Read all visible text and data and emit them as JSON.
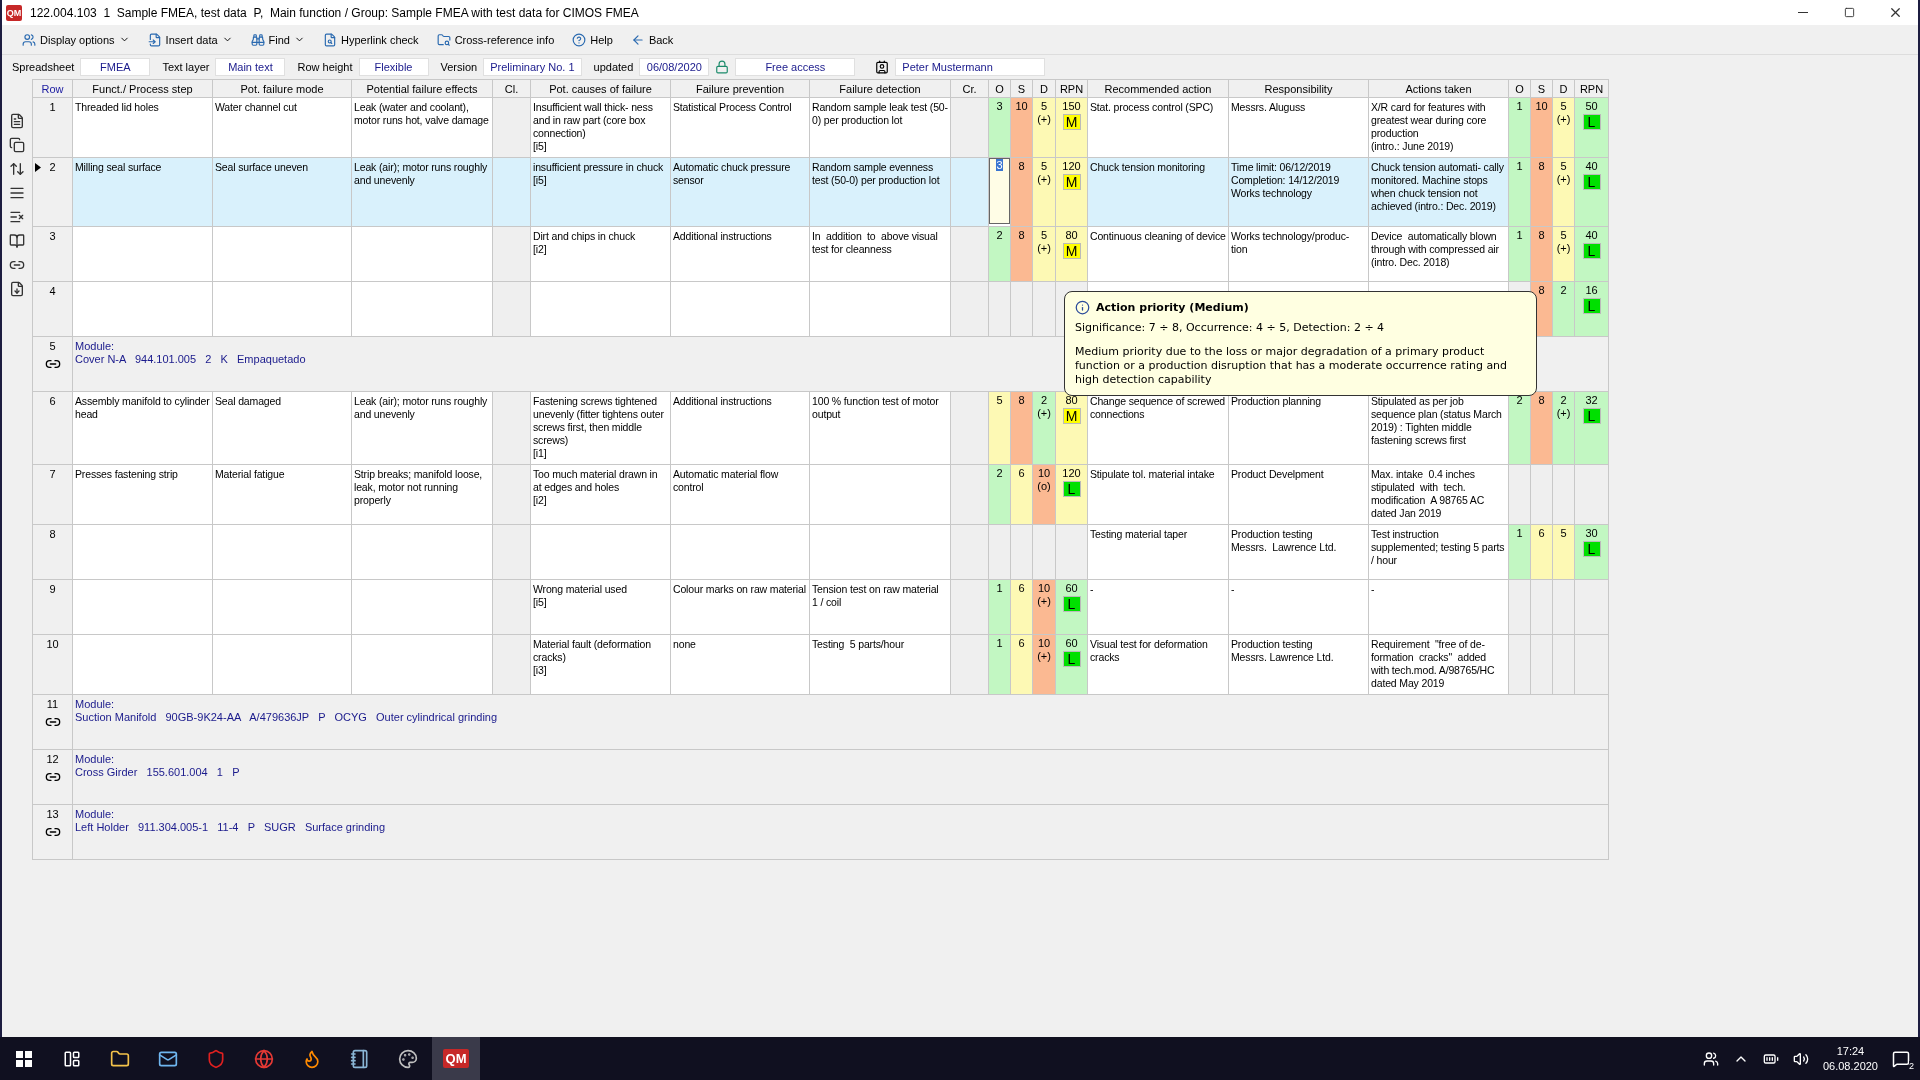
{
  "window": {
    "title": "122.004.103  1  Sample FMEA, test data  P,  Main function / Group: Sample FMEA with test data for CIMOS FMEA",
    "app_icon": "QM"
  },
  "toolbar": [
    {
      "label": "Display options",
      "dropdown": true
    },
    {
      "label": "Insert data",
      "dropdown": true
    },
    {
      "label": "Find",
      "dropdown": true
    },
    {
      "label": "Hyperlink check",
      "dropdown": false
    },
    {
      "label": "Cross-reference info",
      "dropdown": false
    },
    {
      "label": "Help",
      "dropdown": false
    },
    {
      "label": "Back",
      "dropdown": false
    }
  ],
  "settings": [
    {
      "label": "Spreadsheet",
      "value": "FMEA"
    },
    {
      "label": "Text layer",
      "value": "Main text"
    },
    {
      "label": "Row height",
      "value": "Flexible"
    },
    {
      "label": "Version",
      "value": "Preliminary No. 1"
    },
    {
      "label": "updated",
      "value": "06/08/2020"
    }
  ],
  "access": "Free access",
  "user": "Peter Mustermann",
  "table": {
    "columns": [
      "Row",
      "Funct./ Process step",
      "Pot. failure mode",
      "Potential failure effects",
      "Cl.",
      "Pot. causes of failure",
      "Failure prevention",
      "Failure detection",
      "Cr.",
      "O",
      "S",
      "D",
      "RPN",
      "Recommended action",
      "Responsibility",
      "Actions taken",
      "O",
      "S",
      "D",
      "RPN"
    ],
    "rows": [
      {
        "kind": "entry",
        "row": "1",
        "selected": false,
        "function": "Threaded lid holes",
        "failure_mode": "Water channel cut",
        "effects": "Leak (water and coolant), motor runs hot, valve damage",
        "causes": "Insufficient wall thick- ness and in raw part (core box connection)\n[i5]",
        "prevention": "Statistical Process Control",
        "detection": "Random sample leak test (50-0) per production lot",
        "before": {
          "o": "3",
          "s": "10",
          "d": "5",
          "d_note": "(+)",
          "rpn": "150",
          "ap": {
            "label": "M",
            "color": "#ffff00"
          },
          "focused": false
        },
        "action": "Stat. process control (SPC)",
        "responsibility": "Messrs. Aluguss",
        "taken": "X/R card for features with greatest wear during core production\n(intro.: June 2019)",
        "after": {
          "o": "1",
          "s": "10",
          "d": "5",
          "d_note": "(+)",
          "rpn": "50",
          "ap": {
            "label": "L",
            "color": "#00e000"
          }
        }
      },
      {
        "kind": "entry",
        "row": "2",
        "selected": true,
        "function": "Milling seal surface",
        "failure_mode": "Seal surface uneven",
        "effects": "Leak (air); motor runs roughly and unevenly",
        "causes": "insufficient pressure in chuck\n[i5]",
        "prevention": "Automatic chuck pressure sensor",
        "detection": "Random sample evenness test (50-0) per production lot",
        "before": {
          "o": "3",
          "s": "8",
          "d": "5",
          "d_note": "(+)",
          "rpn": "120",
          "ap": {
            "label": "M",
            "color": "#ffff00"
          },
          "focused": true
        },
        "action": "Chuck tension monitoring",
        "responsibility": "Time limit: 06/12/2019\nCompletion: 14/12/2019\nWorks technology",
        "taken": "Chuck tension automati- cally monitored. Machine stops when chuck tension not achieved (intro.: Dec. 2019)",
        "after": {
          "o": "1",
          "s": "8",
          "d": "5",
          "d_note": "(+)",
          "rpn": "40",
          "ap": {
            "label": "L",
            "color": "#00e000"
          }
        }
      },
      {
        "kind": "entry",
        "row": "3",
        "selected": false,
        "causes": "Dirt and chips in chuck\n[i2]",
        "prevention": "Additional instructions",
        "detection": "In  addition  to  above visual test for cleanness",
        "before": {
          "o": "2",
          "s": "8",
          "d": "5",
          "d_note": "(+)",
          "rpn": "80",
          "ap": {
            "label": "M",
            "color": "#ffff00"
          },
          "focused": false
        },
        "action": "Continuous cleaning of device",
        "responsibility": "Works technology/produc- tion",
        "taken": "Device  automatically blown through with compressed air (intro. Dec. 2018)",
        "after": {
          "o": "1",
          "s": "8",
          "d": "5",
          "d_note": "(+)",
          "rpn": "40",
          "ap": {
            "label": "L",
            "color": "#00e000"
          }
        }
      },
      {
        "kind": "entry",
        "row": "4",
        "selected": false,
        "after": {
          "s": "8",
          "d": "2",
          "rpn": "16",
          "ap": {
            "label": "L",
            "color": "#00e000"
          }
        }
      },
      {
        "kind": "module",
        "row": "5",
        "title": "Module:",
        "detail": "Cover N-A   944.101.005   2   K   Empaquetado"
      },
      {
        "kind": "entry",
        "row": "6",
        "selected": false,
        "function": "Assembly manifold to cylinder head",
        "failure_mode": "Seal damaged",
        "effects": "Leak (air); motor runs roughly and unevenly",
        "causes": "Fastening screws tightened unevenly (fitter tightens outer screws first, then middle screws)\n[i1]",
        "prevention": "Additional instructions",
        "detection": "100 % function test of motor output",
        "before": {
          "o": "5",
          "s": "8",
          "d": "2",
          "d_note": "(+)",
          "rpn": "80",
          "ap": {
            "label": "M",
            "color": "#ffff00"
          },
          "focused": false
        },
        "action": "Change sequence of screwed connections",
        "responsibility": "Production planning",
        "taken": "Stipulated as per job sequence plan (status March 2019) : Tighten middle fastening screws first",
        "after": {
          "o": "2",
          "s": "8",
          "d": "2",
          "d_note": "(+)",
          "rpn": "32",
          "ap": {
            "label": "L",
            "color": "#00e000"
          }
        }
      },
      {
        "kind": "entry",
        "row": "7",
        "selected": false,
        "function": "Presses fastening strip",
        "failure_mode": "Material fatigue",
        "effects": "Strip breaks; manifold loose, leak, motor not running properly",
        "causes": "Too much material drawn in at edges and holes\n[i2]",
        "prevention": "Automatic material flow control",
        "before": {
          "o": "2",
          "s": "6",
          "d": "10",
          "d_note": "(o)",
          "rpn": "120",
          "ap": {
            "label": "L",
            "color": "#00e000"
          },
          "focused": false
        },
        "action": "Stipulate tol. material intake",
        "responsibility": "Product Develpment",
        "taken": "Max. intake  0.4 inches stipulated  with  tech. modification  A 98765 AC dated Jan 2019"
      },
      {
        "kind": "entry",
        "row": "8",
        "selected": false,
        "action": "Testing material taper",
        "responsibility": "Production testing\nMessrs.  Lawrence Ltd.",
        "taken": "Test instruction supplemented; testing 5 parts\n/ hour",
        "after": {
          "o": "1",
          "s": "6",
          "d": "5",
          "rpn": "30",
          "ap": {
            "label": "L",
            "color": "#00e000"
          }
        }
      },
      {
        "kind": "entry",
        "row": "9",
        "selected": false,
        "causes": "Wrong material used\n[i5]",
        "prevention": "Colour marks on raw material",
        "detection": "Tension test on raw material   1 / coil",
        "before": {
          "o": "1",
          "s": "6",
          "d": "10",
          "d_note": "(+)",
          "rpn": "60",
          "ap": {
            "label": "L",
            "color": "#00e000"
          },
          "focused": false
        },
        "action": "-",
        "responsibility": "-",
        "taken": "-"
      },
      {
        "kind": "entry",
        "row": "10",
        "selected": false,
        "causes": "Material fault (deformation cracks)\n[i3]",
        "prevention": "none",
        "detection": "Testing  5 parts/hour",
        "before": {
          "o": "1",
          "s": "6",
          "d": "10",
          "d_note": "(+)",
          "rpn": "60",
          "ap": {
            "label": "L",
            "color": "#00e000"
          },
          "focused": false
        },
        "action": "Visual test for deformation cracks",
        "responsibility": "Production testing\nMessrs. Lawrence Ltd.",
        "taken": "Requirement  \"free of de- formation  cracks\"  added with tech.mod. A/98765/HC dated May 2019"
      },
      {
        "kind": "module",
        "row": "11",
        "title": "Module:",
        "detail": "Suction Manifold   90GB-9K24-AA   A/479636JP   P   OCYG   Outer cylindrical grinding"
      },
      {
        "kind": "module",
        "row": "12",
        "title": "Module:",
        "detail": "Cross Girder   155.601.004   1   P"
      },
      {
        "kind": "module",
        "row": "13",
        "title": "Module:",
        "detail": "Left Holder   911.304.005-1   11-4   P   SUGR   Surface grinding"
      }
    ]
  },
  "tooltip": {
    "title": "Action priority  (Medium)",
    "criteria": "Significance: 7 ÷ 8, Occurrence: 4 ÷ 5, Detection: 2 ÷ 4",
    "body": "Medium priority due to the loss or major degradation of a primary product function or a production disruption that has a moderate occurrence rating and high detection capability"
  },
  "taskbar": {
    "app_icon": "QM",
    "time": "17:24",
    "date": "06.08.2020",
    "notifications": "2"
  }
}
